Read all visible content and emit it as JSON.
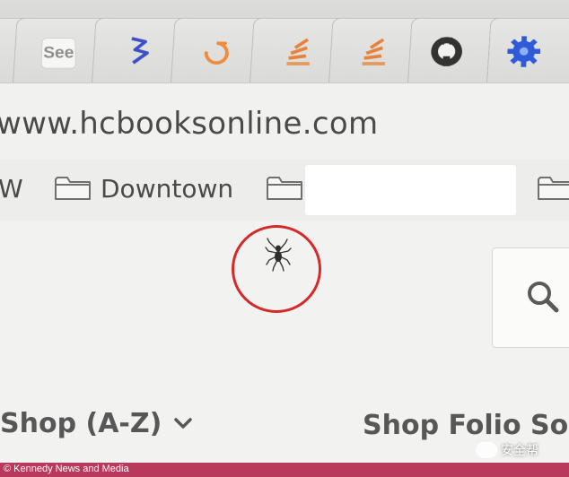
{
  "browser": {
    "tabs": [
      {
        "icon": "see-icon",
        "label": "See"
      },
      {
        "icon": "flag-icon"
      },
      {
        "icon": "swirl-icon"
      },
      {
        "icon": "stackoverflow-icon"
      },
      {
        "icon": "stackoverflow-icon"
      },
      {
        "icon": "github-icon"
      },
      {
        "icon": "gear-icon"
      }
    ],
    "address": "www.hcbooksonline.com",
    "bookmarks": [
      {
        "label": "W"
      },
      {
        "label": "Downtown",
        "icon": "folder-icon"
      },
      {
        "label": "",
        "icon": "folder-icon",
        "redacted": true
      },
      {
        "label": "",
        "icon": "folder-icon"
      }
    ]
  },
  "page": {
    "nav": {
      "shop_az": "Shop (A-Z)",
      "shop_folio": "Shop Folio Soc"
    },
    "annotation_color": "#d42a2a"
  },
  "watermark": "安全帮",
  "caption": "© Kennedy News and Media",
  "colors": {
    "caption_bar": "#b8395c",
    "tab_orange": "#f08a3c",
    "tab_blue": "#2f5bd6"
  }
}
